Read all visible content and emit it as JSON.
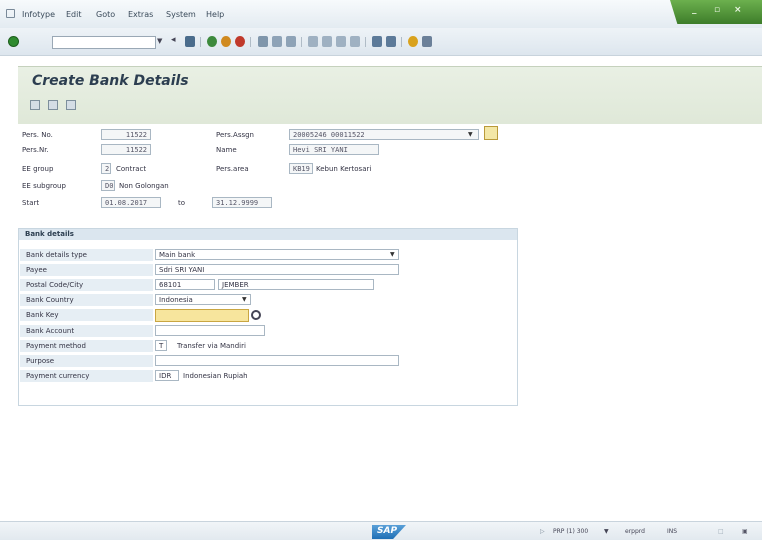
{
  "menu": {
    "items": [
      "Infotype",
      "Edit",
      "Goto",
      "Extras",
      "System",
      "Help"
    ]
  },
  "title": "Create Bank Details",
  "header": {
    "pers_no_label": "Pers. No.",
    "pers_no": "11522",
    "pers_nr_label": "Pers.Nr.",
    "pers_nr": "11522",
    "pers_assign_label": "Pers.Assgn",
    "pers_assign": "20005246 00011522",
    "name_label": "Name",
    "name": "Hevi SRI YANI",
    "ee_group_label": "EE group",
    "ee_group_code": "2",
    "ee_group_text": "Contract",
    "pers_area_label": "Pers.area",
    "pers_area_code": "KB19",
    "pers_area_text": "Kebun Kertosari",
    "ee_subgroup_label": "EE subgroup",
    "ee_subgroup_code": "D0",
    "ee_subgroup_text": "Non Golongan",
    "start_label": "Start",
    "start": "01.08.2017",
    "to_label": "to",
    "end": "31.12.9999"
  },
  "bank_details": {
    "title": "Bank details",
    "type_label": "Bank details type",
    "type_value": "Main bank",
    "payee_label": "Payee",
    "payee_value": "Sdri SRI YANI",
    "postal_label": "Postal Code/City",
    "postal_code": "68101",
    "city": "JEMBER",
    "country_label": "Bank Country",
    "country_value": "Indonesia",
    "bank_key_label": "Bank Key",
    "bank_key_value": "",
    "account_label": "Bank Account",
    "account_value": "",
    "payment_method_label": "Payment method",
    "payment_method_code": "T",
    "payment_method_text": "Transfer via Mandiri",
    "purpose_label": "Purpose",
    "purpose_value": "",
    "currency_label": "Payment currency",
    "currency_code": "IDR",
    "currency_text": "Indonesian Rupiah"
  },
  "status": {
    "system": "PRP (1) 300",
    "server": "erpprd",
    "mode": "INS"
  },
  "colors": {
    "title_band": "#e3ebdd",
    "group_header": "#dbe6ef",
    "required_field": "#f7e59d",
    "win_controls": "#4f9638"
  }
}
